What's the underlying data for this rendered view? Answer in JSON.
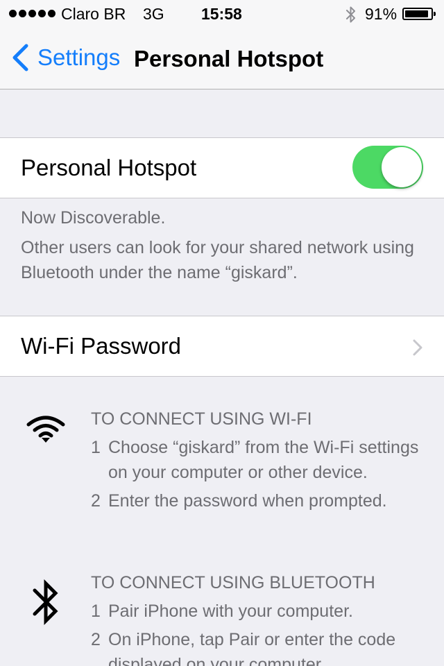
{
  "status_bar": {
    "carrier": "Claro BR",
    "network": "3G",
    "time": "15:58",
    "battery_percent": "91%",
    "battery_level": 0.91,
    "signal_icon": "signal-dots-icon",
    "bluetooth_icon": "bluetooth-icon"
  },
  "nav": {
    "back_label": "Settings",
    "title": "Personal Hotspot"
  },
  "hotspot": {
    "label": "Personal Hotspot",
    "enabled": true,
    "toggle_color": "#4cd964"
  },
  "discoverable": {
    "line1": "Now Discoverable.",
    "line2": "Other users can look for your shared network using Bluetooth under the name “giskard”."
  },
  "wifi_password": {
    "label": "Wi-Fi Password"
  },
  "wifi_section": {
    "icon": "wifi-icon",
    "heading": "TO CONNECT USING WI-FI",
    "steps": [
      {
        "num": "1",
        "text": "Choose “giskard” from the Wi-Fi settings on your computer or other device."
      },
      {
        "num": "2",
        "text": "Enter the password when prompted."
      }
    ]
  },
  "bluetooth_section": {
    "icon": "bluetooth-icon",
    "heading": "TO CONNECT USING BLUETOOTH",
    "steps": [
      {
        "num": "1",
        "text": "Pair iPhone with your computer."
      },
      {
        "num": "2",
        "text": "On iPhone, tap Pair or enter the code displayed on your computer."
      }
    ]
  },
  "colors": {
    "accent": "#147efb",
    "background": "#efeff4",
    "footer_text": "#6d6d72"
  }
}
